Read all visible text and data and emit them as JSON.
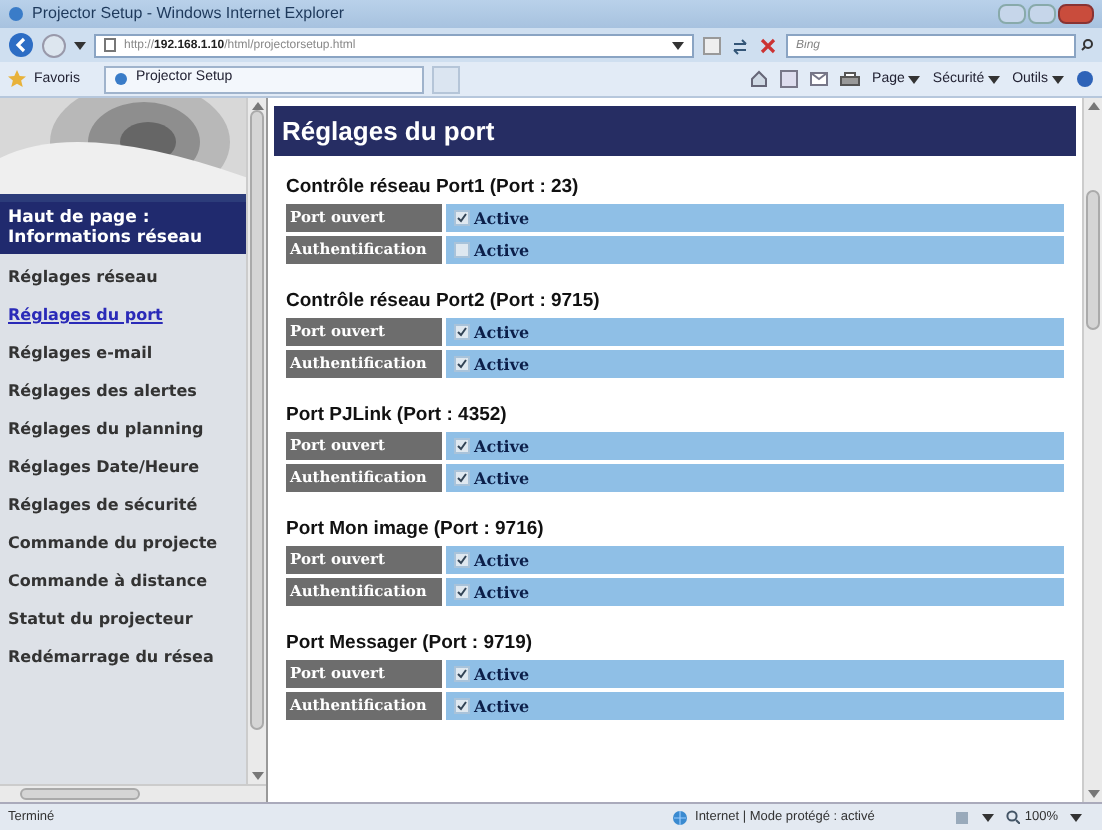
{
  "window": {
    "title": "Projector Setup - Windows Internet Explorer"
  },
  "address_bar": {
    "url": "http://**192.168.1.10**/html/projectorsetup.html",
    "search_placeholder": "Bing"
  },
  "favorites_bar": {
    "favorites": "Favoris",
    "tab": "Projector Setup",
    "menus": [
      "Page",
      "Sécurité",
      "Outils"
    ]
  },
  "sidebar": {
    "home": "Haut de page : Informations réseau",
    "items": [
      {
        "label": "Réglages réseau",
        "selected": false
      },
      {
        "label": "Réglages du port",
        "selected": true
      },
      {
        "label": "Réglages e-mail",
        "selected": false
      },
      {
        "label": "Réglages des alertes",
        "selected": false
      },
      {
        "label": "Réglages du planning",
        "selected": false
      },
      {
        "label": "Réglages Date/Heure",
        "selected": false
      },
      {
        "label": "Réglages de sécurité",
        "selected": false
      },
      {
        "label": "Commande du projecte",
        "selected": false
      },
      {
        "label": "Commande à distance",
        "selected": false
      },
      {
        "label": "Statut du projecteur",
        "selected": false
      },
      {
        "label": "Redémarrage du résea",
        "selected": false
      }
    ]
  },
  "page_title": "Réglages du port",
  "sections": [
    {
      "title": "Contrôle réseau Port1 (Port : 23)",
      "rows": [
        {
          "label": "Port ouvert",
          "checked": true,
          "value": "Active"
        },
        {
          "label": "Authentification",
          "checked": false,
          "value": "Active"
        }
      ]
    },
    {
      "title": "Contrôle réseau Port2 (Port : 9715)",
      "rows": [
        {
          "label": "Port ouvert",
          "checked": true,
          "value": "Active"
        },
        {
          "label": "Authentification",
          "checked": true,
          "value": "Active"
        }
      ]
    },
    {
      "title": "Port PJLink (Port : 4352)",
      "rows": [
        {
          "label": "Port ouvert",
          "checked": true,
          "value": "Active"
        },
        {
          "label": "Authentification",
          "checked": true,
          "value": "Active"
        }
      ]
    },
    {
      "title": "Port Mon image (Port : 9716)",
      "rows": [
        {
          "label": "Port ouvert",
          "checked": true,
          "value": "Active"
        },
        {
          "label": "Authentification",
          "checked": true,
          "value": "Active"
        }
      ]
    },
    {
      "title": "Port Messager (Port : 9719)",
      "rows": [
        {
          "label": "Port ouvert",
          "checked": true,
          "value": "Active"
        },
        {
          "label": "Authentification",
          "checked": true,
          "value": "Active"
        }
      ]
    }
  ],
  "status_bar": {
    "status": "Terminé",
    "zone": "Internet | Mode protégé : activé",
    "zoom": "100%"
  }
}
